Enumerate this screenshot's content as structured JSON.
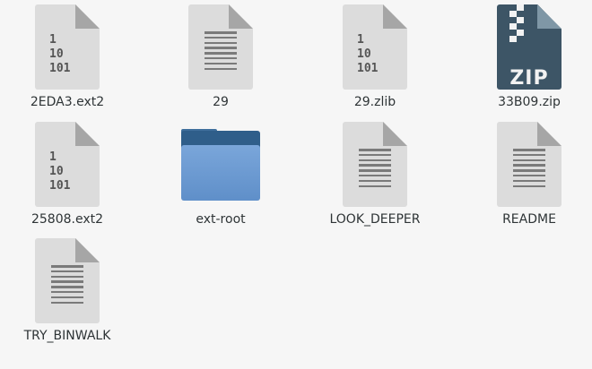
{
  "files": [
    {
      "name": "2EDA3.ext2",
      "icon": "binary-file-icon"
    },
    {
      "name": "29",
      "icon": "text-file-icon"
    },
    {
      "name": "29.zlib",
      "icon": "binary-file-icon"
    },
    {
      "name": "33B09.zip",
      "icon": "zip-archive-icon"
    },
    {
      "name": "25808.ext2",
      "icon": "binary-file-icon"
    },
    {
      "name": "ext-root",
      "icon": "folder-icon"
    },
    {
      "name": "LOOK_DEEPER",
      "icon": "text-file-icon"
    },
    {
      "name": "README",
      "icon": "text-file-icon"
    },
    {
      "name": "TRY_BINWALK",
      "icon": "text-file-icon"
    }
  ],
  "binary_glyph": [
    "1",
    "10",
    "101"
  ],
  "zip_label": "ZIP",
  "colors": {
    "background": "#f6f6f6",
    "page": "#dcdcdc",
    "folder": "#6c9bd2",
    "zip": "#3d5566"
  }
}
